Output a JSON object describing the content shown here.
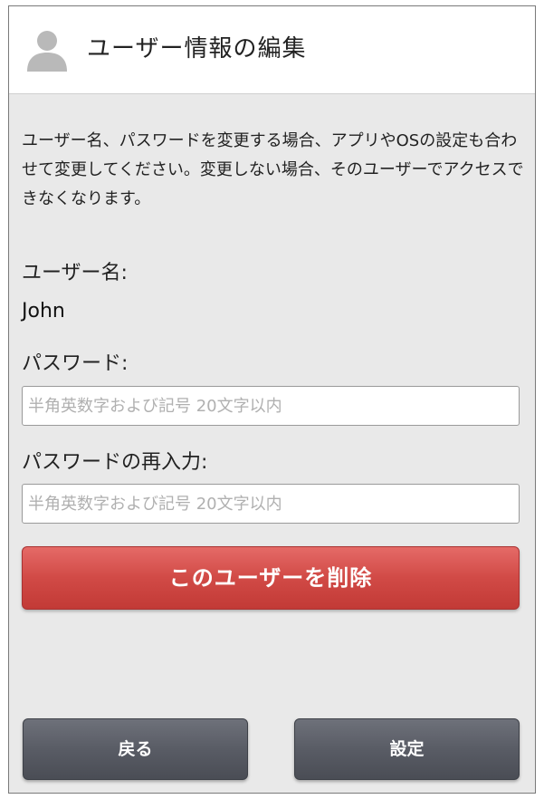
{
  "header": {
    "title": "ユーザー情報の編集",
    "icon": "user-icon"
  },
  "notice": "ユーザー名、パスワードを変更する場合、アプリやOSの設定も合わせて変更してください。変更しない場合、そのユーザーでアクセスできなくなります。",
  "username": {
    "label": "ユーザー名:",
    "value": "John"
  },
  "password": {
    "label": "パスワード:",
    "placeholder": "半角英数字および記号 20文字以内"
  },
  "password_confirm": {
    "label": "パスワードの再入力:",
    "placeholder": "半角英数字および記号 20文字以内"
  },
  "buttons": {
    "delete": "このユーザーを削除",
    "back": "戻る",
    "confirm": "設定"
  },
  "colors": {
    "delete_button": "#d14a46",
    "footer_button": "#595c65",
    "background": "#e9e9e9"
  }
}
